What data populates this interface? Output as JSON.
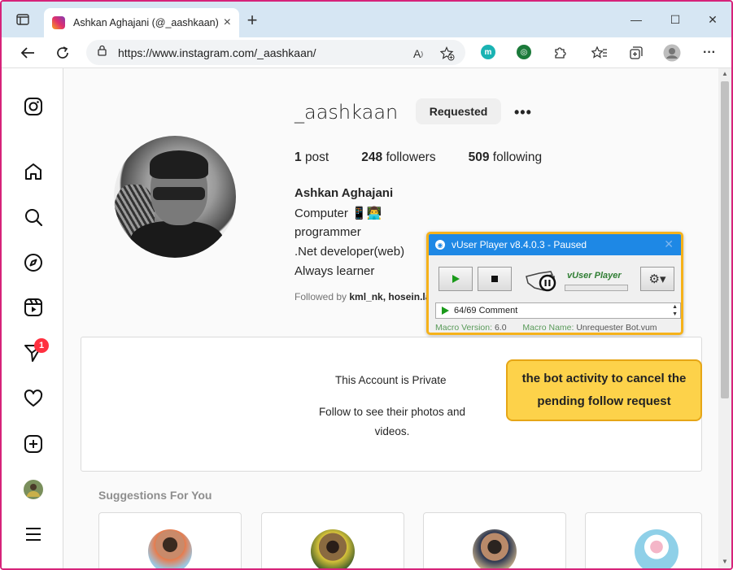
{
  "browser": {
    "tab_title": "Ashkan Aghajani (@_aashkaan) •",
    "url": "https://www.instagram.com/_aashkaan/",
    "new_tab_symbol": "+"
  },
  "profile": {
    "username": "_aashkaan",
    "requested_label": "Requested",
    "more_label": "•••",
    "posts_count": "1",
    "posts_label": "post",
    "followers_count": "248",
    "followers_label": "followers",
    "following_count": "509",
    "following_label": "following",
    "full_name": "Ashkan Aghajani",
    "bio_lines": [
      "Computer 📱👨‍💻",
      "programmer",
      ".Net developer(web)",
      "Always learner"
    ],
    "followed_by_prefix": "Followed by",
    "followed_by_names": "kml_nk, hosein.la"
  },
  "nav": {
    "notification_count": "1"
  },
  "private": {
    "title": "This Account is Private",
    "subtitle": "Follow to see their photos and videos."
  },
  "suggestions": {
    "title": "Suggestions For You"
  },
  "vuser": {
    "title": "vUser Player v8.4.0.3 - Paused",
    "brand": "vUser Player",
    "step": "64/69 Comment",
    "version_label": "Macro Version:",
    "version_value": "6.0",
    "macro_label": "Macro Name:",
    "macro_value": "Unrequester Bot.vum"
  },
  "callout": {
    "text": "the bot activity to cancel the pending follow request"
  },
  "colors": {
    "accent_frame": "#d6237a",
    "instagram_badge": "#ff3040",
    "vuser_titlebar": "#1e88e5",
    "callout_bg": "#fdd24a"
  }
}
